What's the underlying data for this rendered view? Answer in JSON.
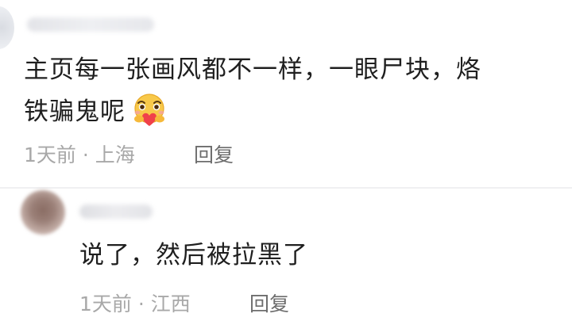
{
  "comment_1": {
    "username": "",
    "text_line_1": "主页每一张画风都不一样，一眼尸块，烙",
    "text_line_2": "铁骗鬼呢",
    "emoji": "heart-hug-emoji",
    "time_location": "1天前 · 上海",
    "reply_label": "回复"
  },
  "comment_2": {
    "username": "",
    "text": "说了，然后被拉黑了",
    "time_location": "1天前 · 江西",
    "reply_label": "回复"
  },
  "colors": {
    "text_primary": "#1f1f1f",
    "meta_text": "#a8a8a8",
    "reply_text": "#6d6d6d",
    "emoji_face": "#f8c94a",
    "emoji_heart": "#f0414a",
    "background": "#ffffff"
  }
}
